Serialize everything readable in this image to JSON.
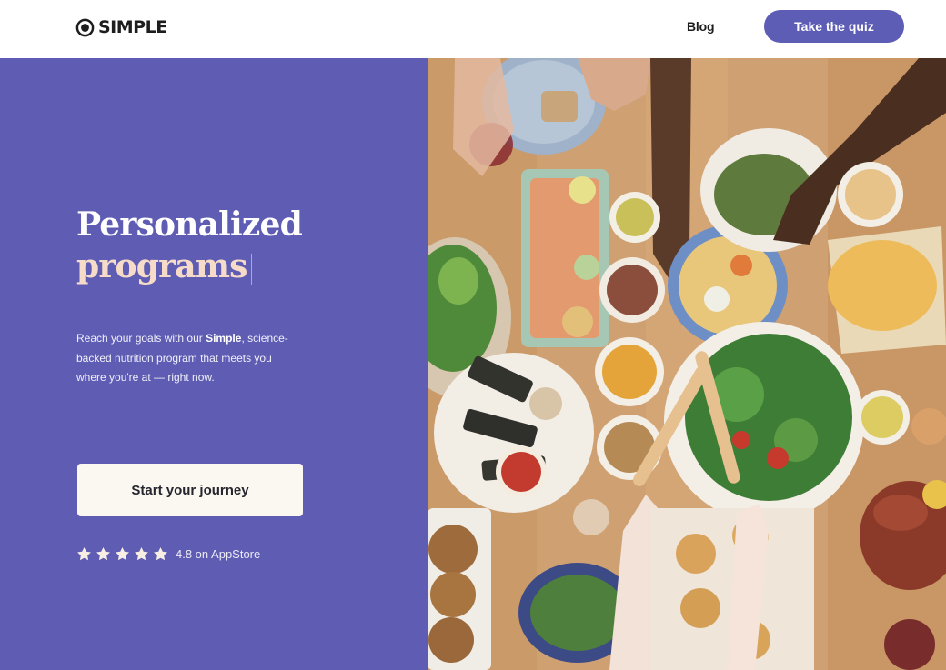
{
  "header": {
    "logo_text": "SIMPLE",
    "nav_blog": "Blog",
    "quiz_button": "Take the quiz"
  },
  "hero": {
    "title_line1": "Personalized",
    "title_line2": "programs",
    "description_before": "Reach your goals with our ",
    "description_bold": "Simple",
    "description_after": ", science-backed nutrition program that meets you where you're at — right now.",
    "cta_button": "Start your journey",
    "rating": {
      "stars": 5,
      "text": "4.8 on AppStore"
    }
  },
  "image": {
    "subject": "food-table-photo"
  },
  "colors": {
    "brand_purple": "#5e5cb3",
    "button_purple": "#5d5db5",
    "title_accent": "#f6dcc8",
    "cta_bg": "#fbf7f1"
  }
}
